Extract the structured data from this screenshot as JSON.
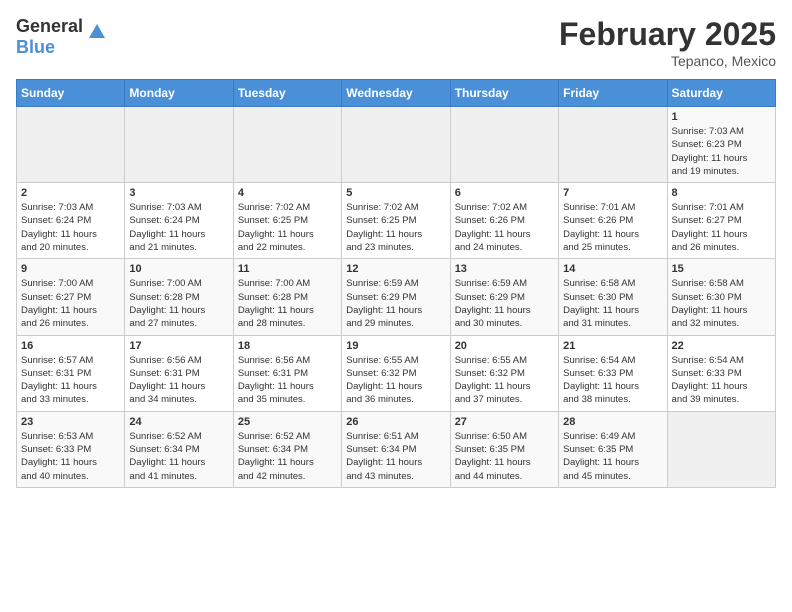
{
  "header": {
    "logo_general": "General",
    "logo_blue": "Blue",
    "month_year": "February 2025",
    "location": "Tepanco, Mexico"
  },
  "weekdays": [
    "Sunday",
    "Monday",
    "Tuesday",
    "Wednesday",
    "Thursday",
    "Friday",
    "Saturday"
  ],
  "weeks": [
    [
      {
        "day": "",
        "info": ""
      },
      {
        "day": "",
        "info": ""
      },
      {
        "day": "",
        "info": ""
      },
      {
        "day": "",
        "info": ""
      },
      {
        "day": "",
        "info": ""
      },
      {
        "day": "",
        "info": ""
      },
      {
        "day": "1",
        "info": "Sunrise: 7:03 AM\nSunset: 6:23 PM\nDaylight: 11 hours\nand 19 minutes."
      }
    ],
    [
      {
        "day": "2",
        "info": "Sunrise: 7:03 AM\nSunset: 6:24 PM\nDaylight: 11 hours\nand 20 minutes."
      },
      {
        "day": "3",
        "info": "Sunrise: 7:03 AM\nSunset: 6:24 PM\nDaylight: 11 hours\nand 21 minutes."
      },
      {
        "day": "4",
        "info": "Sunrise: 7:02 AM\nSunset: 6:25 PM\nDaylight: 11 hours\nand 22 minutes."
      },
      {
        "day": "5",
        "info": "Sunrise: 7:02 AM\nSunset: 6:25 PM\nDaylight: 11 hours\nand 23 minutes."
      },
      {
        "day": "6",
        "info": "Sunrise: 7:02 AM\nSunset: 6:26 PM\nDaylight: 11 hours\nand 24 minutes."
      },
      {
        "day": "7",
        "info": "Sunrise: 7:01 AM\nSunset: 6:26 PM\nDaylight: 11 hours\nand 25 minutes."
      },
      {
        "day": "8",
        "info": "Sunrise: 7:01 AM\nSunset: 6:27 PM\nDaylight: 11 hours\nand 26 minutes."
      }
    ],
    [
      {
        "day": "9",
        "info": "Sunrise: 7:00 AM\nSunset: 6:27 PM\nDaylight: 11 hours\nand 26 minutes."
      },
      {
        "day": "10",
        "info": "Sunrise: 7:00 AM\nSunset: 6:28 PM\nDaylight: 11 hours\nand 27 minutes."
      },
      {
        "day": "11",
        "info": "Sunrise: 7:00 AM\nSunset: 6:28 PM\nDaylight: 11 hours\nand 28 minutes."
      },
      {
        "day": "12",
        "info": "Sunrise: 6:59 AM\nSunset: 6:29 PM\nDaylight: 11 hours\nand 29 minutes."
      },
      {
        "day": "13",
        "info": "Sunrise: 6:59 AM\nSunset: 6:29 PM\nDaylight: 11 hours\nand 30 minutes."
      },
      {
        "day": "14",
        "info": "Sunrise: 6:58 AM\nSunset: 6:30 PM\nDaylight: 11 hours\nand 31 minutes."
      },
      {
        "day": "15",
        "info": "Sunrise: 6:58 AM\nSunset: 6:30 PM\nDaylight: 11 hours\nand 32 minutes."
      }
    ],
    [
      {
        "day": "16",
        "info": "Sunrise: 6:57 AM\nSunset: 6:31 PM\nDaylight: 11 hours\nand 33 minutes."
      },
      {
        "day": "17",
        "info": "Sunrise: 6:56 AM\nSunset: 6:31 PM\nDaylight: 11 hours\nand 34 minutes."
      },
      {
        "day": "18",
        "info": "Sunrise: 6:56 AM\nSunset: 6:31 PM\nDaylight: 11 hours\nand 35 minutes."
      },
      {
        "day": "19",
        "info": "Sunrise: 6:55 AM\nSunset: 6:32 PM\nDaylight: 11 hours\nand 36 minutes."
      },
      {
        "day": "20",
        "info": "Sunrise: 6:55 AM\nSunset: 6:32 PM\nDaylight: 11 hours\nand 37 minutes."
      },
      {
        "day": "21",
        "info": "Sunrise: 6:54 AM\nSunset: 6:33 PM\nDaylight: 11 hours\nand 38 minutes."
      },
      {
        "day": "22",
        "info": "Sunrise: 6:54 AM\nSunset: 6:33 PM\nDaylight: 11 hours\nand 39 minutes."
      }
    ],
    [
      {
        "day": "23",
        "info": "Sunrise: 6:53 AM\nSunset: 6:33 PM\nDaylight: 11 hours\nand 40 minutes."
      },
      {
        "day": "24",
        "info": "Sunrise: 6:52 AM\nSunset: 6:34 PM\nDaylight: 11 hours\nand 41 minutes."
      },
      {
        "day": "25",
        "info": "Sunrise: 6:52 AM\nSunset: 6:34 PM\nDaylight: 11 hours\nand 42 minutes."
      },
      {
        "day": "26",
        "info": "Sunrise: 6:51 AM\nSunset: 6:34 PM\nDaylight: 11 hours\nand 43 minutes."
      },
      {
        "day": "27",
        "info": "Sunrise: 6:50 AM\nSunset: 6:35 PM\nDaylight: 11 hours\nand 44 minutes."
      },
      {
        "day": "28",
        "info": "Sunrise: 6:49 AM\nSunset: 6:35 PM\nDaylight: 11 hours\nand 45 minutes."
      },
      {
        "day": "",
        "info": ""
      }
    ]
  ]
}
